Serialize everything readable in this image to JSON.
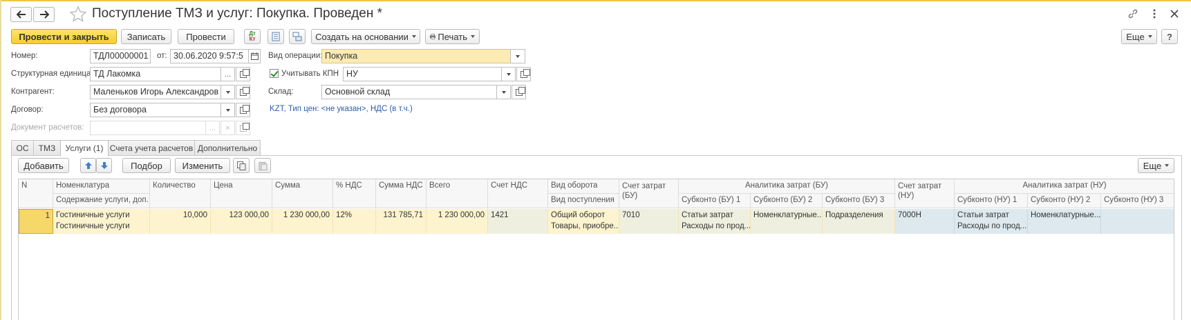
{
  "window": {
    "title": "Поступление ТМЗ и услуг: Покупка. Проведен *"
  },
  "toolbar": {
    "post_close": "Провести и закрыть",
    "save": "Записать",
    "post": "Провести",
    "create_based": "Создать на основании",
    "print": "Печать",
    "more": "Еще"
  },
  "form": {
    "number_label": "Номер:",
    "number_value": "ТДЛ00000001",
    "date_label": "от:",
    "date_value": "30.06.2020  9:57:5",
    "op_type_label": "Вид операции:",
    "op_type_value": "Покупка",
    "unit_label": "Структурная единица:",
    "unit_value": "ТД Лакомка",
    "kpn_label": "Учитывать КПН",
    "kpn_value": "НУ",
    "counterparty_label": "Контрагент:",
    "counterparty_value": "Маленьков Игорь Александров",
    "warehouse_label": "Склад:",
    "warehouse_value": "Основной склад",
    "contract_label": "Договор:",
    "contract_value": "Без договора",
    "prices_link": "KZT, Тип цен: <не указан>, НДС (в т.ч.)",
    "settlement_doc_label": "Документ расчетов:",
    "settlement_doc_value": ""
  },
  "tabs": [
    {
      "label": "ОС"
    },
    {
      "label": "ТМЗ"
    },
    {
      "label": "Услуги (1)"
    },
    {
      "label": "Счета учета расчетов"
    },
    {
      "label": "Дополнительно"
    }
  ],
  "table_toolbar": {
    "add": "Добавить",
    "pick": "Подбор",
    "edit": "Изменить",
    "more": "Еще"
  },
  "table": {
    "headers": {
      "n": "N",
      "nomenclature": "Номенклатура",
      "content": "Содержание услуги, доп.",
      "qty": "Количество",
      "price": "Цена",
      "sum": "Сумма",
      "vat_pct": "% НДС",
      "vat_sum": "Сумма НДС",
      "total": "Всего",
      "vat_account": "Счет НДС",
      "turnover_type": "Вид оборота",
      "receipt_type": "Вид поступления",
      "cost_account_bu": "Счет затрат (БУ)",
      "analytics_bu": "Аналитика затрат (БУ)",
      "sub_bu1": "Субконто (БУ) 1",
      "sub_bu2": "Субконто (БУ) 2",
      "sub_bu3": "Субконто (БУ) 3",
      "cost_account_nu": "Счет затрат (НУ)",
      "analytics_nu": "Аналитика затрат (НУ)",
      "sub_nu1": "Субконто (НУ) 1",
      "sub_nu2": "Субконто (НУ) 2",
      "sub_nu3": "Субконто (НУ) 3"
    },
    "rows": [
      {
        "n": "1",
        "nomenclature": "Гостиничные услуги",
        "content": "Гостиничные услуги",
        "qty": "10,000",
        "price": "123 000,00",
        "sum": "1 230 000,00",
        "vat_pct": "12%",
        "vat_sum": "131 785,71",
        "total": "1 230 000,00",
        "vat_account": "1421",
        "turnover_type": "Общий оборот",
        "receipt_type": "Товары, приобре...",
        "cost_account_bu": "7010",
        "sub_bu1_a": "Статьи затрат",
        "sub_bu1_b": "Расходы по прод...",
        "sub_bu2": "Номенклатурные...",
        "sub_bu3": "Подразделения",
        "cost_account_nu": "7000Н",
        "sub_nu1_a": "Статьи затрат",
        "sub_nu1_b": "Расходы по прод...",
        "sub_nu2": "Номенклатурные...",
        "sub_nu3": ""
      }
    ]
  }
}
